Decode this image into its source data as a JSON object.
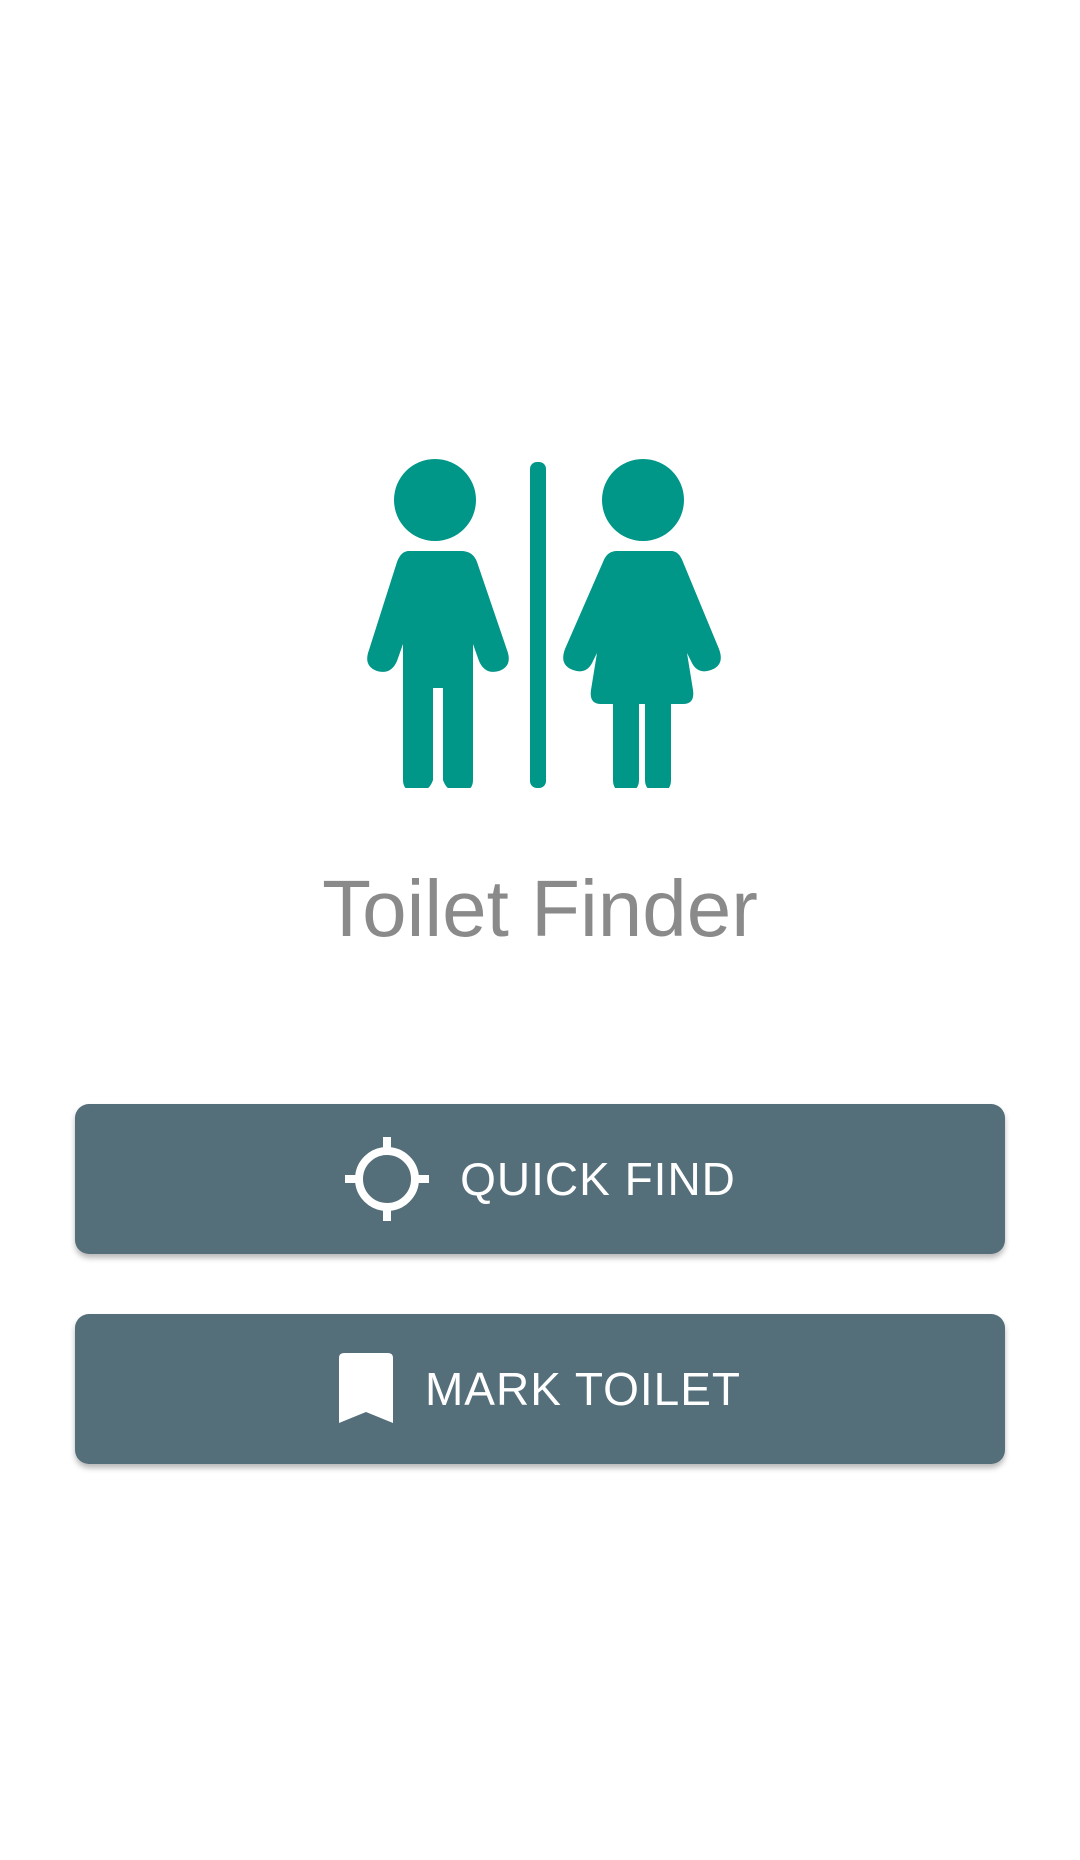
{
  "app": {
    "title": "Toilet Finder",
    "logo_icon": "restroom-icon",
    "accent_color": "#009688"
  },
  "actions": {
    "button_color": "#546e7a",
    "quick_find": {
      "label": "QUICK FIND",
      "icon": "crosshair-icon"
    },
    "mark_toilet": {
      "label": "MARK TOILET",
      "icon": "bookmark-icon"
    }
  }
}
